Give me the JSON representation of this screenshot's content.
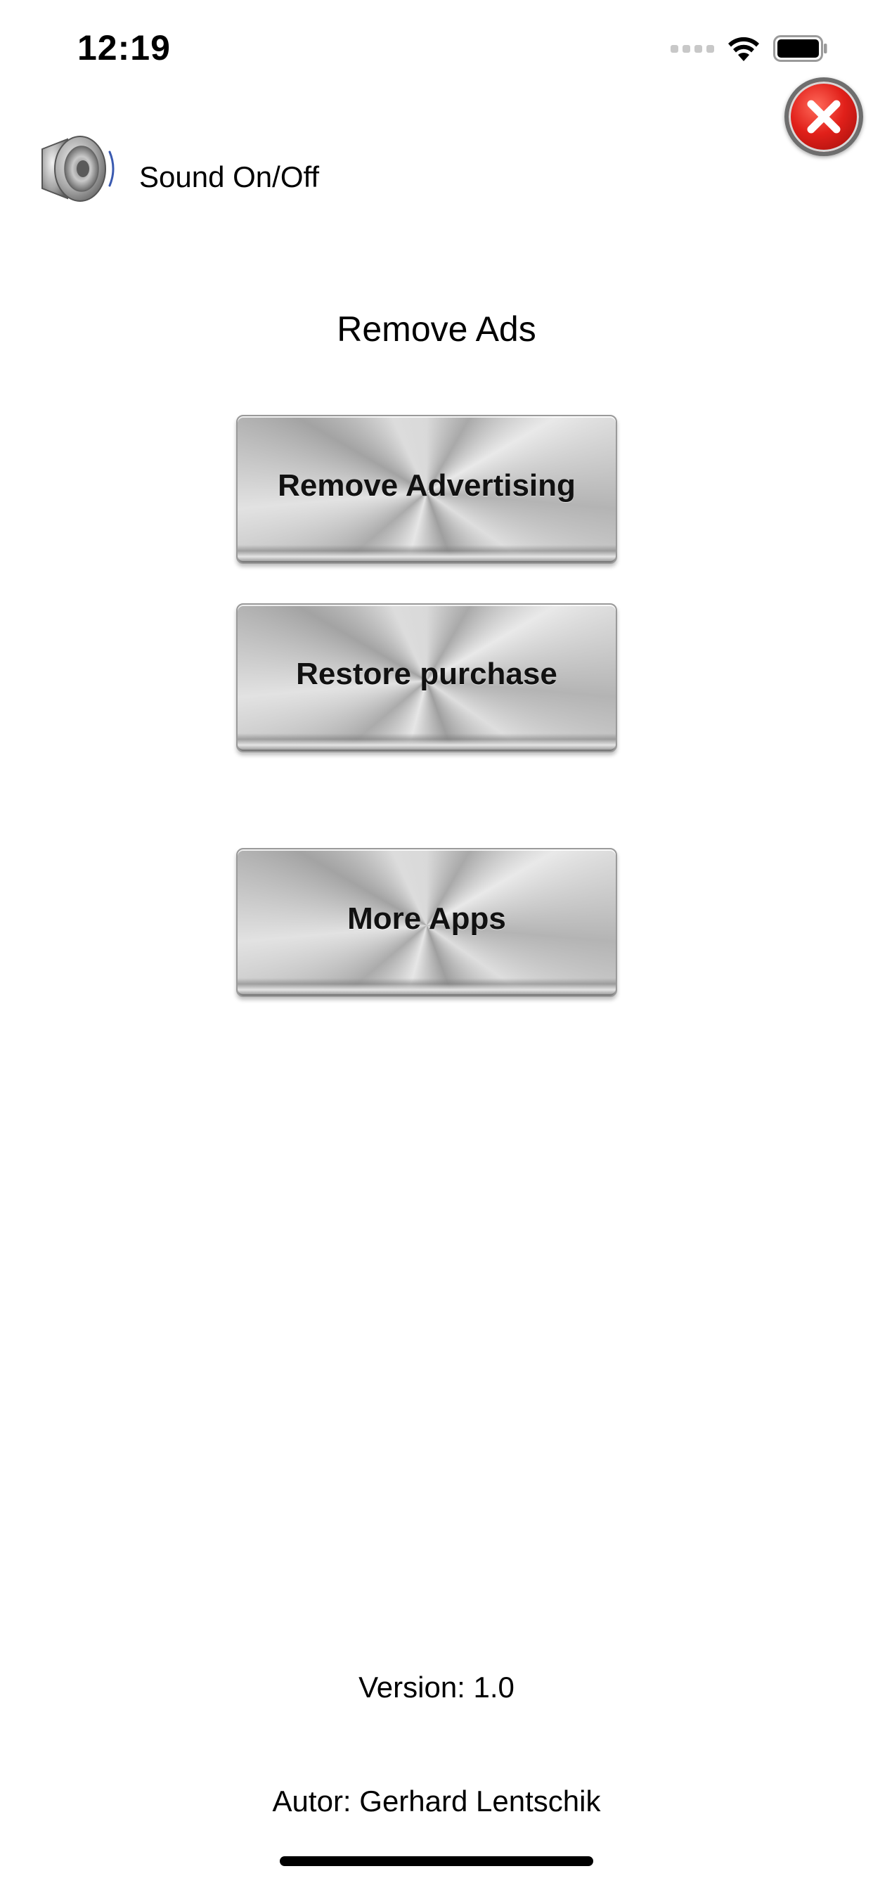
{
  "status_bar": {
    "time": "12:19",
    "icons": [
      "signal-dots-icon",
      "wifi-icon",
      "battery-icon"
    ]
  },
  "header": {
    "close_icon": "close-icon",
    "sound_icon": "speaker-icon",
    "sound_label": "Sound On/Off"
  },
  "main": {
    "title": "Remove Ads",
    "buttons": [
      {
        "label": "Remove Advertising"
      },
      {
        "label": "Restore purchase"
      },
      {
        "label": "More Apps"
      }
    ]
  },
  "footer": {
    "version": "Version: 1.0",
    "author": "Autor: Gerhard Lentschik"
  },
  "colors": {
    "close_red": "#e1201a",
    "button_metal": "#c8c8c8",
    "text": "#000000",
    "background": "#ffffff"
  }
}
